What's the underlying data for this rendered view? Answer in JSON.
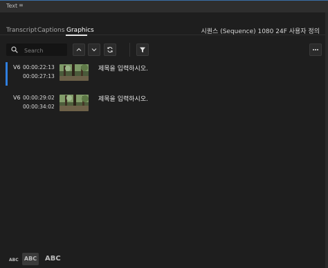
{
  "panel": {
    "title": "Text",
    "menu_icon": "hamburger-icon"
  },
  "tabs": [
    {
      "label": "Transcript",
      "active": false
    },
    {
      "label": "Captions",
      "active": false
    },
    {
      "label": "Graphics",
      "active": true
    }
  ],
  "sequence_title": "시퀀스 (Sequence) 1080 24F 사용자 정의",
  "toolbar": {
    "search_placeholder": "Search",
    "icons": [
      "search-icon",
      "chevron-up-icon",
      "chevron-down-icon",
      "refresh-icon",
      "filter-icon",
      "more-icon"
    ]
  },
  "graphics": [
    {
      "track": "V6",
      "in": "00:00:22:13",
      "out": "00:00:27:13",
      "caption": "제목을 입력하시오.",
      "selected": true
    },
    {
      "track": "V6",
      "in": "00:00:29:02",
      "out": "00:00:34:02",
      "caption": "제목을 입력하시오.",
      "selected": false
    }
  ],
  "text_size": {
    "small": "ABC",
    "medium": "ABC",
    "large": "ABC",
    "selected": "medium"
  },
  "colors": {
    "accent": "#2f7fe0",
    "background": "#1e1e1e"
  }
}
